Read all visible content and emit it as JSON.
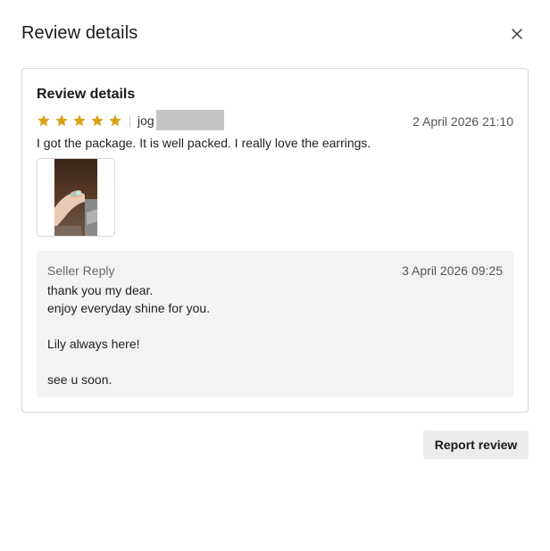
{
  "dialog": {
    "title": "Review details",
    "close_icon": "close-icon"
  },
  "review": {
    "section_title": "Review details",
    "rating": 5,
    "rating_max": 5,
    "star_color": "#d9a21b",
    "username_visible": "jog",
    "date": "2 April 2026 21:10",
    "text": "I got the package. It is well packed. I really love the earrings."
  },
  "seller_reply": {
    "label": "Seller Reply",
    "date": "3 April 2026 09:25",
    "lines": [
      "thank you my dear.",
      "enjoy everyday shine for you.",
      "",
      "Lily always here!",
      "",
      "see u soon."
    ]
  },
  "actions": {
    "report_label": "Report review"
  }
}
